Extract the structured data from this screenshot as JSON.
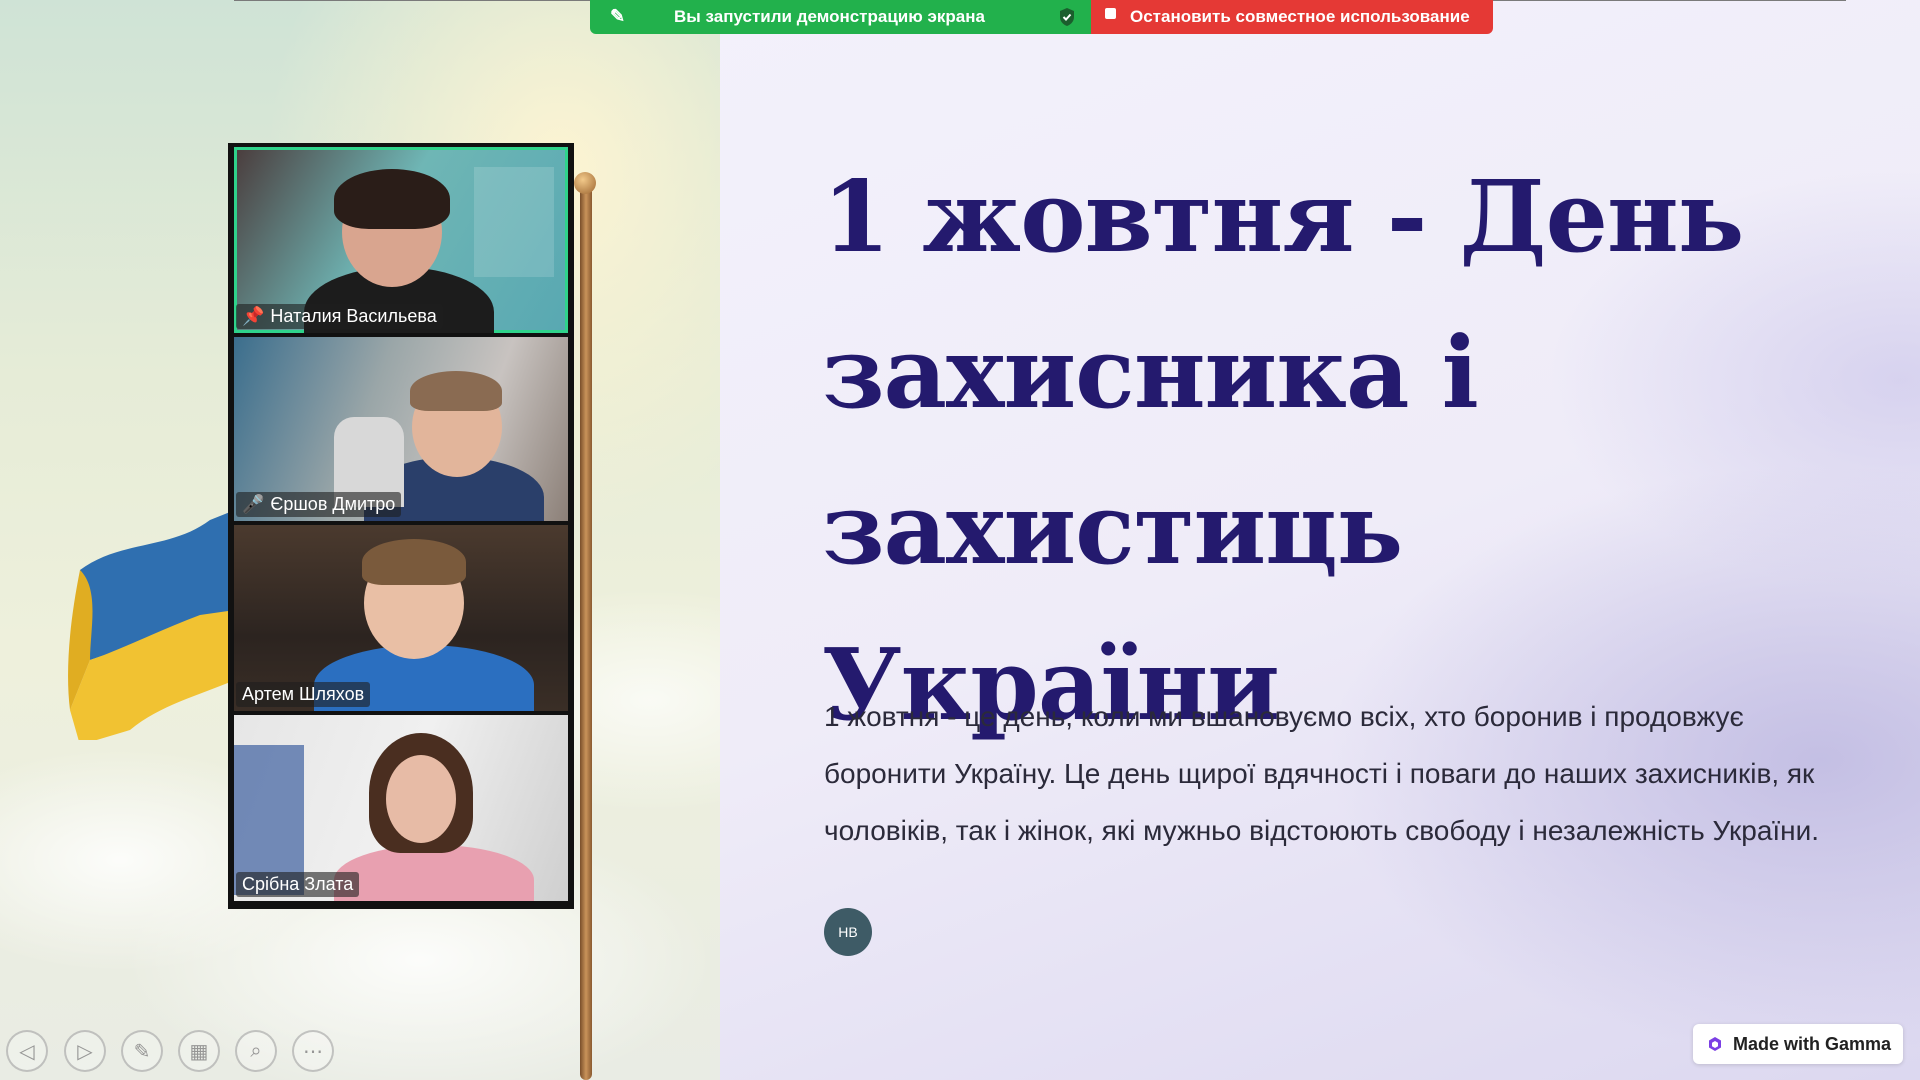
{
  "share_bar": {
    "status_text": "Вы запустили демонстрацию экрана",
    "stop_label": "Остановить совместное использование",
    "colors": {
      "green": "#22b14c",
      "red": "#e53935"
    }
  },
  "participants": [
    {
      "name": "Наталия Васильева",
      "pinned": true,
      "active_speaker": true
    },
    {
      "name": "Єршов Дмитро",
      "muted": true
    },
    {
      "name": "Артем Шляхов"
    },
    {
      "name": "Срібна Злата"
    }
  ],
  "slide": {
    "title": "1 жовтня - День захисника і захистиць України",
    "body": "1 жовтня - це день, коли ми вшановуємо всіх, хто боронив і продовжує боронити Україну. Це день щирої вдячності і поваги до наших захисників, як чоловіків, так і жінок, які мужньо відстоюють свободу і незалежність України.",
    "avatar_initials": "НВ",
    "colors": {
      "title": "#241a6e"
    }
  },
  "gamma_badge": {
    "label": "Made with Gamma"
  },
  "toolbar": {
    "icons": [
      "previous-icon",
      "next-icon",
      "pen-icon",
      "slides-icon",
      "zoom-icon",
      "more-icon"
    ]
  }
}
